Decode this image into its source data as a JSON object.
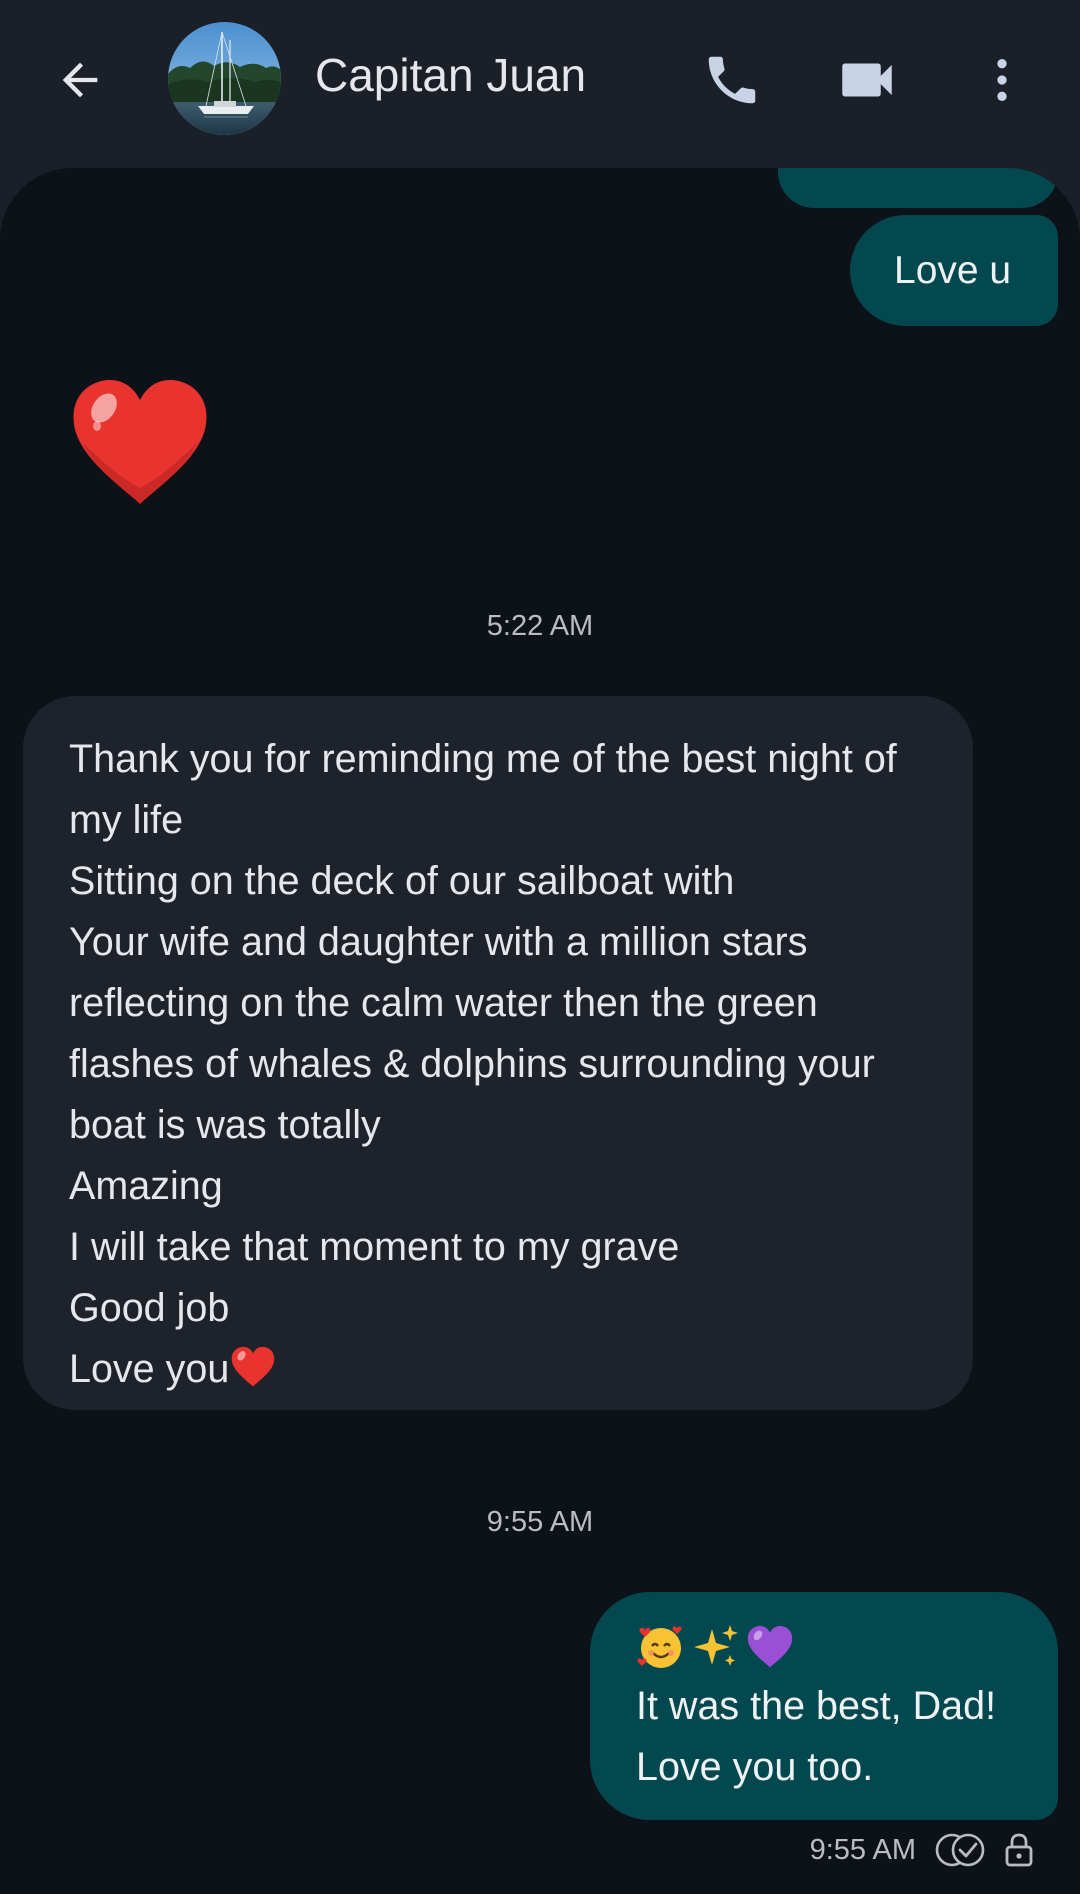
{
  "header": {
    "contact_name": "Capitan Juan",
    "back_icon": "arrow-left-icon",
    "call_icon": "phone-icon",
    "video_icon": "videocam-icon",
    "more_icon": "more-vert-icon"
  },
  "messages": {
    "previous_out": "",
    "love_u": "Love u",
    "heart_emoji": "heart-emoji",
    "timestamp_1": "5:22 AM",
    "incoming_lines": [
      "Thank you for reminding me of the best night of",
      "my life",
      "Sitting on the deck of our sailboat with",
      "Your wife and daughter with a million stars",
      "reflecting on the calm water then the green",
      "flashes of whales & dolphins surrounding your",
      "boat is was totally",
      "Amazing",
      "I will take that moment to my grave",
      "Good job",
      "Love you"
    ],
    "timestamp_2": "9:55 AM",
    "reply_emojis": [
      "smiling-face-with-hearts",
      "sparkles",
      "purple-heart"
    ],
    "reply_lines": [
      "It was the best, Dad!",
      "Love you too."
    ],
    "reply_time": "9:55 AM",
    "reply_status_icon": "double-check-icon",
    "encryption_icon": "lock-icon"
  },
  "colors": {
    "header_bg": "#1b1f27",
    "conversation_bg": "#0d1118",
    "incoming_bubble": "#1e222b",
    "outgoing_bubble": "#04484f",
    "icon_color": "#c8d3e6"
  }
}
